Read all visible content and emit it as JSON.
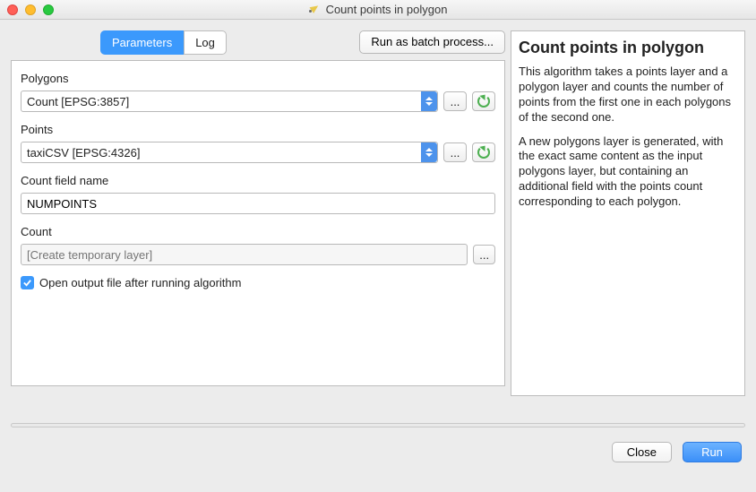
{
  "window": {
    "title": "Count points in polygon"
  },
  "tabs": {
    "parameters": "Parameters",
    "log": "Log",
    "active": "parameters"
  },
  "batch_button": "Run as batch process...",
  "params": {
    "polygons": {
      "label": "Polygons",
      "value": "Count [EPSG:3857]"
    },
    "points": {
      "label": "Points",
      "value": "taxiCSV [EPSG:4326]"
    },
    "count_field": {
      "label": "Count field name",
      "value": "NUMPOINTS"
    },
    "output": {
      "label": "Count",
      "placeholder": "[Create temporary layer]",
      "value": ""
    },
    "open_after": {
      "label": "Open output file after running algorithm",
      "checked": true
    }
  },
  "help": {
    "title": "Count points in polygon",
    "p1": "This algorithm takes a points layer and a polygon layer and counts the number of points from the first one in each polygons of the second one.",
    "p2": "A new polygons layer is generated, with the exact same content as the input polygons layer, but containing an additional field with the points count corresponding to each polygon."
  },
  "footer": {
    "close": "Close",
    "run": "Run"
  },
  "glyph": {
    "dots": "..."
  }
}
